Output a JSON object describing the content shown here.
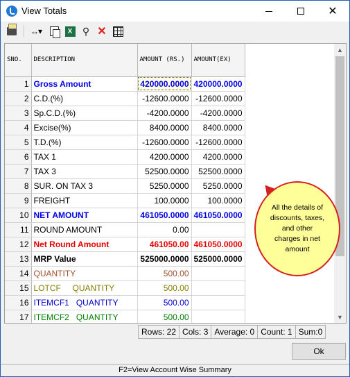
{
  "window": {
    "title": "View Totals"
  },
  "toolbar": {
    "icons": [
      "print-icon",
      "column-width-icon",
      "copy-icon",
      "excel-icon",
      "find-icon",
      "delete-icon",
      "grid-icon"
    ]
  },
  "grid": {
    "headers": {
      "sno": "SNO.",
      "description": "DESCRIPTION",
      "amount": "AMOUNT (RS.)",
      "amount_ex": "AMOUNT(EX)"
    },
    "rows": [
      {
        "sno": "1",
        "description": "Gross Amount",
        "amount": "420000.0000",
        "amount_ex": "420000.0000",
        "style": "blue-bold"
      },
      {
        "sno": "2",
        "description": "C.D.(%)",
        "amount": "-12600.0000",
        "amount_ex": "-12600.0000",
        "style": "normal"
      },
      {
        "sno": "3",
        "description": "Sp.C.D.(%)",
        "amount": "-4200.0000",
        "amount_ex": "-4200.0000",
        "style": "normal"
      },
      {
        "sno": "4",
        "description": "Excise(%)",
        "amount": "8400.0000",
        "amount_ex": "8400.0000",
        "style": "normal"
      },
      {
        "sno": "5",
        "description": "T.D.(%)",
        "amount": "-12600.0000",
        "amount_ex": "-12600.0000",
        "style": "normal"
      },
      {
        "sno": "6",
        "description": "TAX 1",
        "amount": "4200.0000",
        "amount_ex": "4200.0000",
        "style": "normal"
      },
      {
        "sno": "7",
        "description": "TAX 3",
        "amount": "52500.0000",
        "amount_ex": "52500.0000",
        "style": "normal"
      },
      {
        "sno": "8",
        "description": "SUR. ON TAX 3",
        "amount": "5250.0000",
        "amount_ex": "5250.0000",
        "style": "normal"
      },
      {
        "sno": "9",
        "description": "FREIGHT",
        "amount": "100.0000",
        "amount_ex": "100.0000",
        "style": "normal"
      },
      {
        "sno": "10",
        "description": "NET AMOUNT",
        "amount": "461050.0000",
        "amount_ex": "461050.0000",
        "style": "blue-bold"
      },
      {
        "sno": "11",
        "description": "ROUND AMOUNT",
        "amount": "0.00",
        "amount_ex": "",
        "style": "normal"
      },
      {
        "sno": "12",
        "description": "Net Round Amount",
        "amount": "461050.00",
        "amount_ex": "461050.0000",
        "style": "red-bold"
      },
      {
        "sno": "13",
        "description": "MRP Value",
        "amount": "525000.0000",
        "amount_ex": "525000.0000",
        "style": "black-bold"
      },
      {
        "sno": "14",
        "description": "QUANTITY",
        "amount": "500.00",
        "amount_ex": "",
        "style": "brown"
      },
      {
        "sno": "15",
        "description": "LOTCF     QUANTITY",
        "amount": "500.00",
        "amount_ex": "",
        "style": "olive"
      },
      {
        "sno": "16",
        "description": "ITEMCF1   QUANTITY",
        "amount": "500.00",
        "amount_ex": "",
        "style": "blue"
      },
      {
        "sno": "17",
        "description": "ITEMCF2   QUANTITY",
        "amount": "500.00",
        "amount_ex": "",
        "style": "green"
      }
    ]
  },
  "callout": {
    "text": "All the details of discounts, taxes, and other charges in net amount"
  },
  "status": {
    "rows": "Rows: 22",
    "cols": "Cols: 3",
    "average": "Average: 0",
    "count": "Count: 1",
    "sum": "Sum:0"
  },
  "buttons": {
    "ok": "Ok"
  },
  "footer": {
    "text": "F2=View Account Wise Summary"
  },
  "colors": {
    "blue-bold": "#0000e6",
    "red-bold": "#e60000",
    "black-bold": "#000000",
    "brown": "#a0522d",
    "olive": "#808000",
    "blue": "#0000cc",
    "green": "#008000",
    "normal": "#000000"
  }
}
